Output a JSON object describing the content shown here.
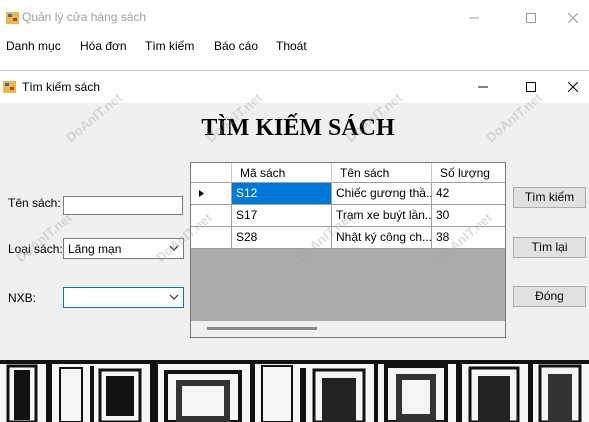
{
  "main_window": {
    "title": "Quản lý cửa hàng sách",
    "menu": [
      "Danh mục",
      "Hóa đơn",
      "Tìm kiếm",
      "Báo cáo",
      "Thoát"
    ]
  },
  "child_window": {
    "title": "Tìm kiếm sách",
    "heading": "TÌM KIẾM SÁCH",
    "labels": {
      "ten_sach": "Tên sách:",
      "loai_sach": "Loại sách:",
      "nxb": "NXB:"
    },
    "inputs": {
      "ten_sach_value": "",
      "loai_sach_value": "Lãng mạn",
      "nxb_value": ""
    },
    "grid": {
      "columns": [
        "Mã sách",
        "Tên sách",
        "Số lượng"
      ],
      "rows": [
        {
          "ma": "S12",
          "ten": "Chiếc gương thầ...",
          "sl": "42"
        },
        {
          "ma": "S17",
          "ten": "Trạm xe buýt lần...",
          "sl": "30"
        },
        {
          "ma": "S28",
          "ten": "Nhật ký công ch...",
          "sl": "38"
        }
      ]
    },
    "buttons": {
      "tim_kiem": "Tìm kiếm",
      "tim_lai": "Tìm lại",
      "dong": "Đóng"
    }
  },
  "watermark": "DoAnIT.net",
  "colors": {
    "selection": "#0078d7",
    "grid_bg": "#ababab",
    "form_bg": "#f0f0f0"
  }
}
